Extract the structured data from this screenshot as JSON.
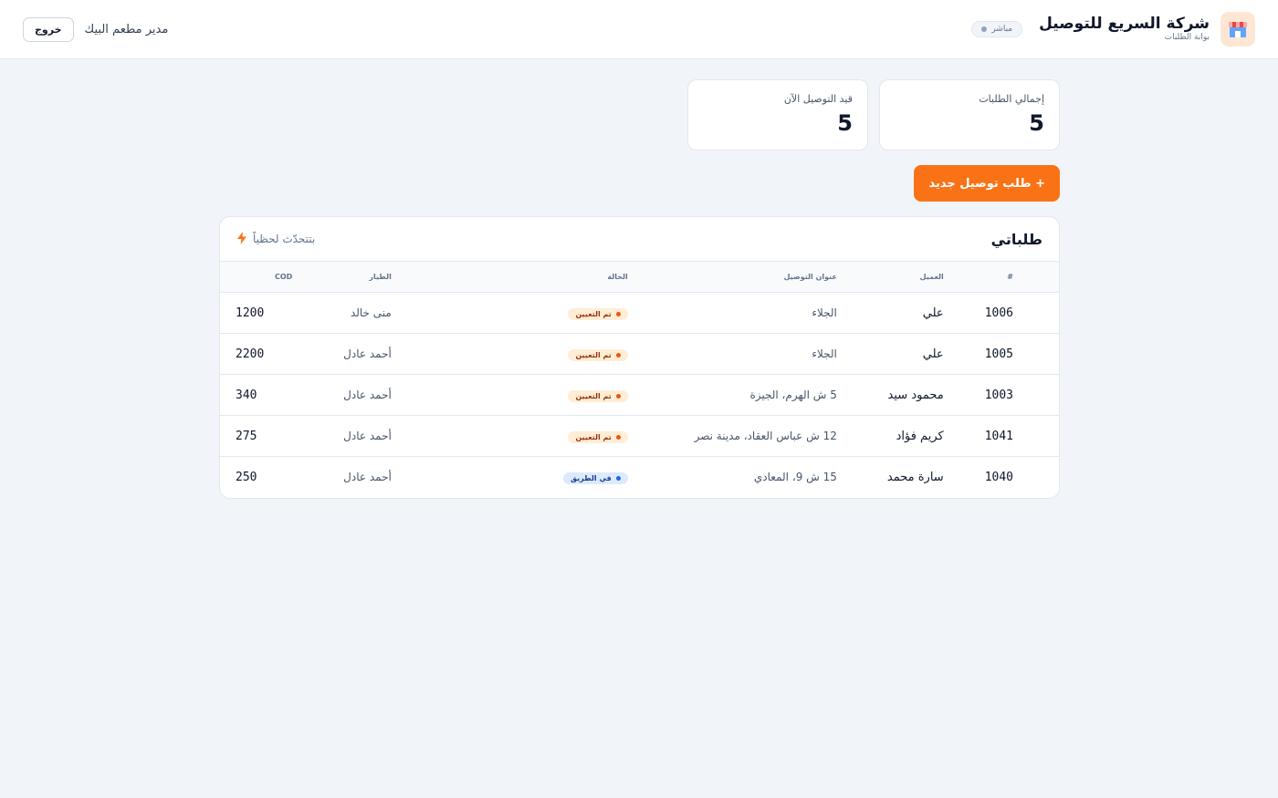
{
  "header": {
    "brand_title": "شركة السريع للتوصيل",
    "brand_subtitle": "بوابة الطلبات",
    "live_badge": "مباشر",
    "user_name": "مدير مطعم البيك",
    "logout_label": "خروج"
  },
  "stats": [
    {
      "label": "إجمالي الطلبات",
      "value": "5"
    },
    {
      "label": "قيد التوصيل الآن",
      "value": "5"
    }
  ],
  "new_order_label": "+ طلب توصيل جديد",
  "orders": {
    "title": "طلباتي",
    "live_update_label": "بتتحدّث لحظياً",
    "columns": {
      "number": "#",
      "customer": "العميل",
      "address": "عنوان التوصيل",
      "status": "الحالة",
      "driver": "الطيار",
      "cod": "COD"
    },
    "rows": [
      {
        "number": "1006",
        "customer": "علي",
        "address": "الجلاء",
        "status": "تم التعيين",
        "status_kind": "assigned",
        "driver": "منى خالد",
        "cod": "1200"
      },
      {
        "number": "1005",
        "customer": "علي",
        "address": "الجلاء",
        "status": "تم التعيين",
        "status_kind": "assigned",
        "driver": "أحمد عادل",
        "cod": "2200"
      },
      {
        "number": "1003",
        "customer": "محمود سيد",
        "address": "5 ش الهرم، الجيزة",
        "status": "تم التعيين",
        "status_kind": "assigned",
        "driver": "أحمد عادل",
        "cod": "340"
      },
      {
        "number": "1041",
        "customer": "كريم فؤاد",
        "address": "12 ش عباس العقاد، مدينة نصر",
        "status": "تم التعيين",
        "status_kind": "assigned",
        "driver": "أحمد عادل",
        "cod": "275"
      },
      {
        "number": "1040",
        "customer": "سارة محمد",
        "address": "15 ش 9، المعادي",
        "status": "في الطريق",
        "status_kind": "onway",
        "driver": "أحمد عادل",
        "cod": "250"
      }
    ]
  },
  "colors": {
    "accent": "#f97316",
    "assigned_bg": "#ffedd5",
    "onway_bg": "#dbeafe"
  },
  "icons": {
    "brand": "storefront-icon",
    "live_update": "lightning-icon"
  }
}
